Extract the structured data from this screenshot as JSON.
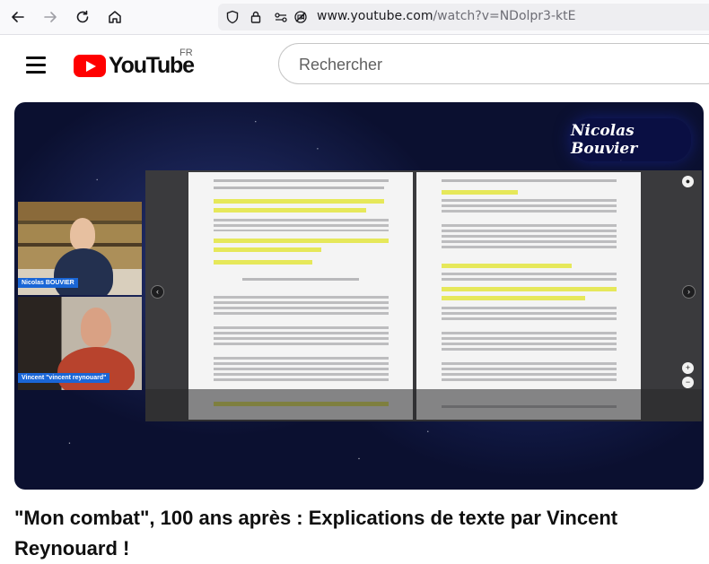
{
  "browser": {
    "url_domain": "www.youtube.com",
    "url_path": "/watch?v=NDolpr3-ktE",
    "icons": [
      "back-icon",
      "forward-icon",
      "reload-icon",
      "home-icon",
      "shield-icon",
      "lock-icon",
      "permissions-icon",
      "no-camera-icon"
    ]
  },
  "youtube": {
    "logo_text": "YouTube",
    "country_code": "FR",
    "search_placeholder": "Rechercher",
    "brand_color": "#ff0000"
  },
  "video": {
    "watermark": "Nicolas Bouvier",
    "participants": [
      "Nicolas BOUVIER",
      "Vincent \"vincent reynouard\""
    ],
    "title": "\"Mon combat\", 100 ans après : Explications de texte par Vincent Reynouard !"
  }
}
